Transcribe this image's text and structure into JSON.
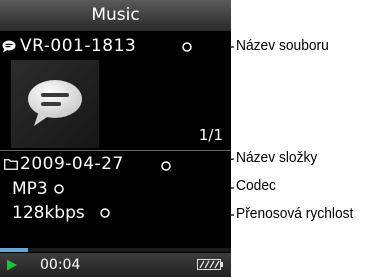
{
  "header": {
    "title": "Music"
  },
  "track": {
    "file_name": "VR-001-1813",
    "count": "1/1",
    "folder_name": "2009-04-27",
    "codec": "MP3",
    "bitrate": "128kbps"
  },
  "playback": {
    "state": "playing",
    "elapsed": "00:04",
    "progress_fraction": 0.12
  },
  "icons": {
    "file": "voice-file-icon",
    "thumbnail": "speech-bubble-icon",
    "folder": "folder-icon",
    "play": "play-icon",
    "battery": "battery-icon"
  },
  "callouts": {
    "file_name": "Název souboru",
    "folder_name": "Název složky",
    "codec": "Codec",
    "bitrate": "Přenosová rychlost"
  },
  "colors": {
    "screen_bg": "#000000",
    "progress": "#6fa3dd",
    "play": "#19c23a"
  }
}
